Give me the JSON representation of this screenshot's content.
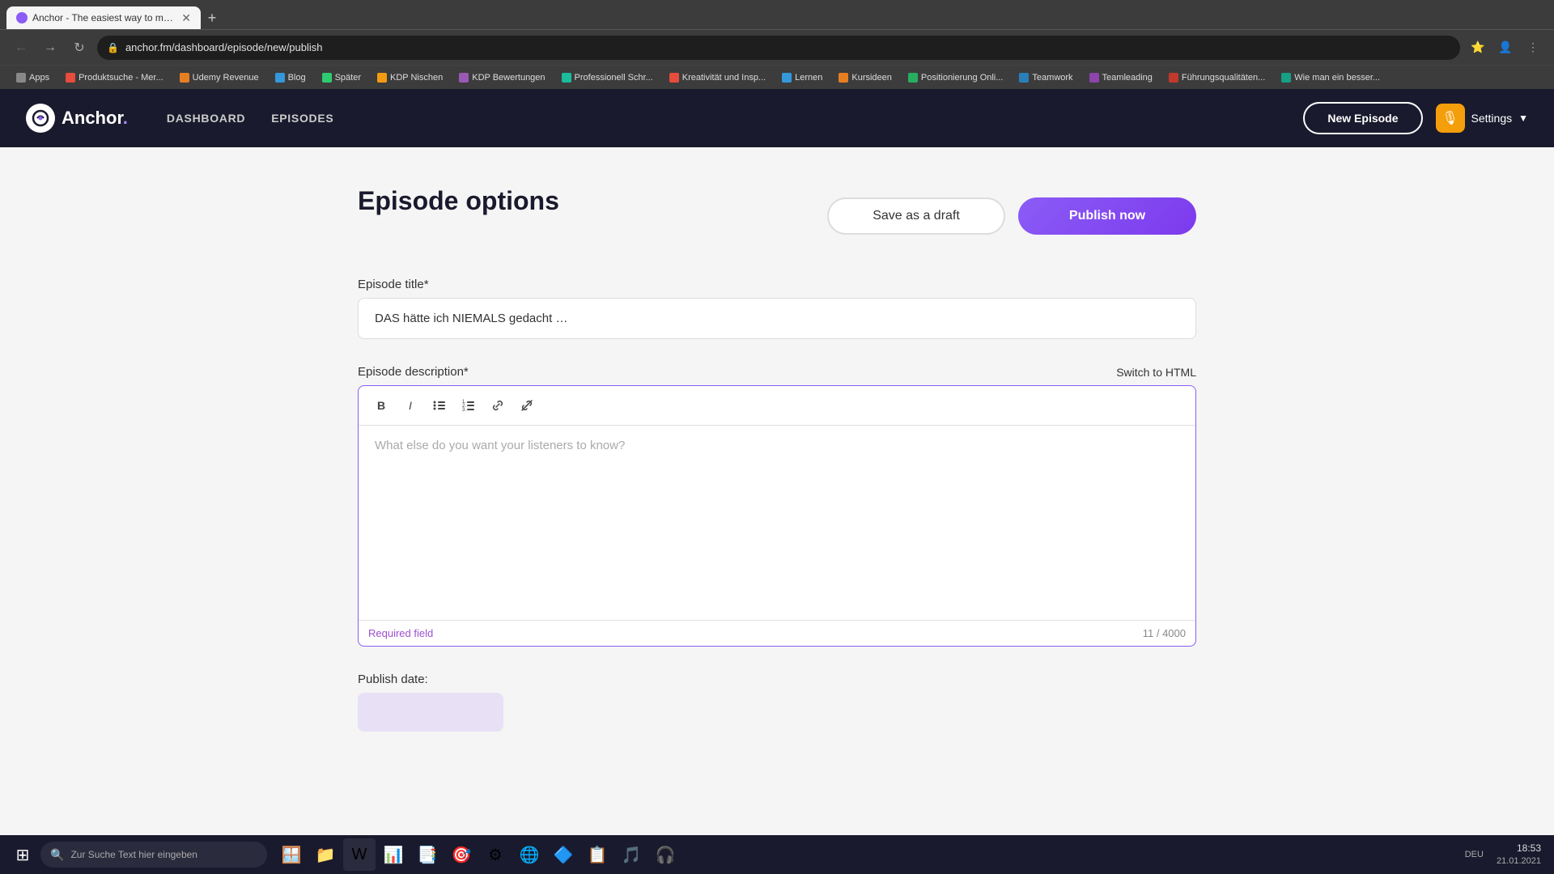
{
  "browser": {
    "tab": {
      "title": "Anchor - The easiest way to mai...",
      "favicon_color": "#8b5cf6"
    },
    "address": "anchor.fm/dashboard/episode/new/publish",
    "bookmarks": [
      {
        "label": "Apps"
      },
      {
        "label": "Produktsuche - Mer..."
      },
      {
        "label": "Udemy Revenue"
      },
      {
        "label": "Blog"
      },
      {
        "label": "Später"
      },
      {
        "label": "KDP Nischen"
      },
      {
        "label": "KDP Bewertungen"
      },
      {
        "label": "Professionell Schr..."
      },
      {
        "label": "Kreativität und Insp..."
      },
      {
        "label": "Lernen"
      },
      {
        "label": "Kursideen"
      },
      {
        "label": "Positionierung Onli..."
      },
      {
        "label": "Teamwork"
      },
      {
        "label": "Teamleading"
      },
      {
        "label": "Führungsqualitäten..."
      },
      {
        "label": "Wie man ein besser..."
      }
    ]
  },
  "navbar": {
    "logo_text": "Anchor",
    "nav_links": [
      {
        "label": "DASHBOARD"
      },
      {
        "label": "EPISODES"
      }
    ],
    "new_episode_label": "New Episode",
    "settings_label": "Settings"
  },
  "page": {
    "title": "Episode options",
    "save_draft_label": "Save as a draft",
    "publish_label": "Publish now"
  },
  "form": {
    "title_label": "Episode title*",
    "title_value": "DAS hätte ich NIEMALS gedacht …",
    "description_label": "Episode description*",
    "switch_html_label": "Switch to HTML",
    "description_placeholder": "What else do you want your listeners to know?",
    "required_field_text": "Required field",
    "char_count": "11 / 4000",
    "publish_date_label": "Publish date:"
  },
  "toolbar": {
    "bold_label": "B",
    "italic_label": "I",
    "unordered_list_label": "≡",
    "ordered_list_label": "≡",
    "link_label": "🔗",
    "unlink_label": "🔗"
  },
  "taskbar": {
    "search_placeholder": "Zur Suche Text hier eingeben",
    "time": "18:53",
    "date": "21.01.2021",
    "lang": "DEU"
  }
}
